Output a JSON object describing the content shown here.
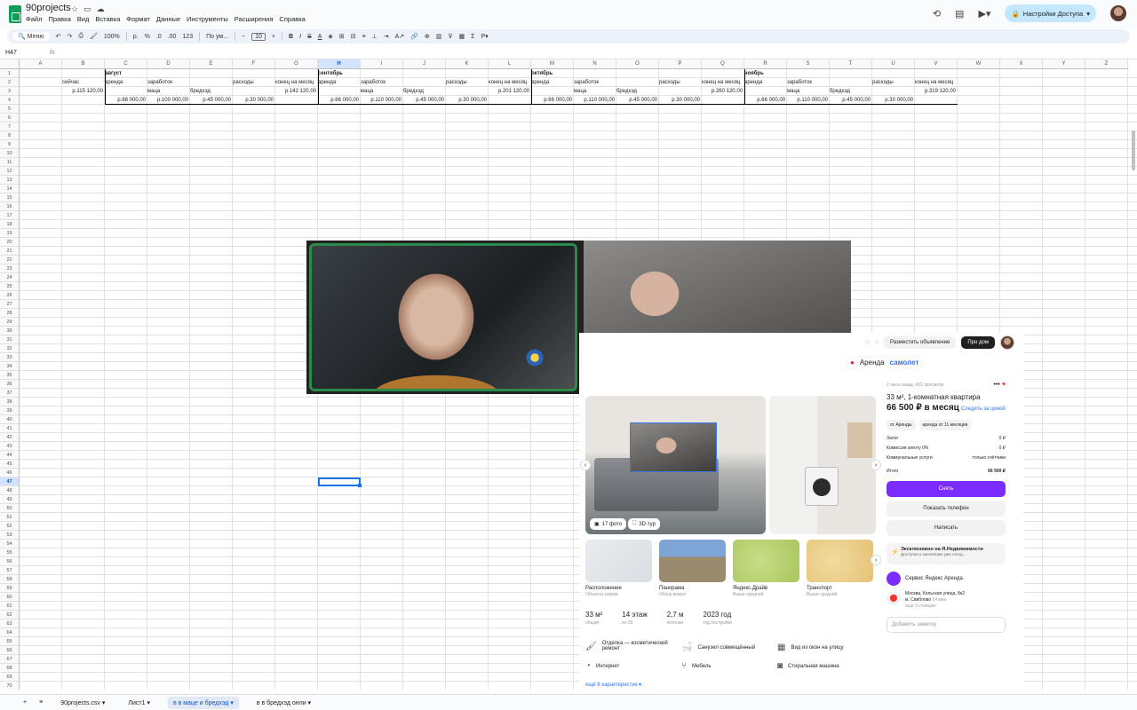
{
  "app": {
    "title": "90projects",
    "menu": [
      "Файл",
      "Правка",
      "Вид",
      "Вставка",
      "Формат",
      "Данные",
      "Инструменты",
      "Расширения",
      "Справка"
    ],
    "share_label": "Настройки Доступа"
  },
  "toolbar": {
    "search": "Меню",
    "zoom": "100%",
    "currency": "р.",
    "percent": "%",
    "dec_minus": ".0",
    "dec_plus": ".00",
    "num_format": "123",
    "font": "По ум...",
    "font_size": "10"
  },
  "formula_bar": {
    "cell_ref": "H47",
    "fx": "fx"
  },
  "columns": [
    "A",
    "B",
    "C",
    "D",
    "E",
    "F",
    "G",
    "H",
    "I",
    "J",
    "K",
    "L",
    "M",
    "N",
    "O",
    "P",
    "Q",
    "R",
    "S",
    "T",
    "U",
    "V",
    "W",
    "X",
    "Y",
    "Z"
  ],
  "selected_col": "H",
  "selected_row": 47,
  "rows_visible": 70,
  "cells": {
    "B2": "сейчас",
    "B3": "р.115 120,00",
    "C1": "август",
    "C2": "аренда",
    "C4": "р.88 000,00",
    "D2": "заработок",
    "D3": "маца",
    "D4": "р.100 000,00",
    "E3": "бредхэд",
    "E4": "р.45 000,00",
    "F2": "расходы",
    "F4": "р.30 000,00",
    "G2": "конец на месяц",
    "G3": "р.142 120,00",
    "H1": "сентябрь",
    "H2": "аренда",
    "H4": "р.66 000,00",
    "I2": "заработок",
    "I3": "маца",
    "I4": "р.110 000,00",
    "J3": "бредхэд",
    "J4": "р.45 000,00",
    "K2": "расходы",
    "K4": "р.30 000,00",
    "L2": "конец на месяц",
    "L3": "р.201 120,00",
    "M1": "октябрь",
    "M2": "аренда",
    "M4": "р.66 000,00",
    "N2": "заработок",
    "N3": "маца",
    "N4": "р.110 000,00",
    "O3": "бредхэд",
    "O4": "р.45 000,00",
    "P2": "расходы",
    "P4": "р.30 000,00",
    "Q2": "конец на месяц",
    "Q3": "р.260 120,00",
    "R1": "ноябрь",
    "R2": "аренда",
    "R4": "р.66 000,00",
    "S2": "заработок",
    "S3": "маца",
    "S4": "р.110 000,00",
    "T3": "бредхэд",
    "T4": "р.45 000,00",
    "U2": "расходы",
    "U4": "р.30 000,00",
    "V2": "конец на месяц",
    "V3": "р.319 120,00"
  },
  "sheets": [
    "90projects.csv",
    "Лист1",
    "в в маце и бредхэд",
    "в в бредхэд онли"
  ],
  "active_sheet": "в в маце и бредхэд",
  "listing": {
    "post_button": "Разместить объявление",
    "pro_button": "Про дом",
    "brand_a": "Аренда",
    "brand_b": "самолет",
    "meta": "2 часа назад, 431 просмотр",
    "title": "33 м², 1-комнатная квартира",
    "price": "66 500 ₽ в месяц",
    "follow": "Следить за ценой",
    "chip1": "от Аренды",
    "chip2": "аренда от 11 месяцев",
    "rows": [
      {
        "k": "Залог",
        "v": "0 ₽"
      },
      {
        "k": "Комиссия агенту 0%",
        "v": "0 ₽"
      },
      {
        "k": "Коммунальные услуги",
        "v": "только счётчики"
      }
    ],
    "total_k": "Итого",
    "total_v": "66 500 ₽",
    "rent_btn": "Снять",
    "phone_btn": "Показать телефон",
    "write_btn": "Написать",
    "promo_title": "Эксклюзивно на Я.Недвижимости",
    "promo_sub": "Доступна к заселению уже сегод...",
    "service": "Сервис Яндекс Аренда",
    "address1": "Москва, Кольская улица, 8к2",
    "address2": "м. Свиблово",
    "address2b": "14 мин.",
    "address3": "ещё 3 станции",
    "note": "Добавить заметку",
    "photos": "17 фото",
    "tour": "3D-тур",
    "thumbs": [
      {
        "title": "Расположение",
        "sub": "Объекты рядом"
      },
      {
        "title": "Панорама",
        "sub": "Обзор вокруг"
      },
      {
        "title": "Яндекс.Драйв",
        "sub": "Выше средней"
      },
      {
        "title": "Транспорт",
        "sub": "Выше средней"
      }
    ],
    "stats": [
      {
        "v": "33 м²",
        "l": "общая"
      },
      {
        "v": "14 этаж",
        "l": "из 25"
      },
      {
        "v": "2,7 м",
        "l": "потолки"
      },
      {
        "v": "2023 год",
        "l": "год постройки"
      }
    ],
    "features": [
      "Отделка — косметический ремонт",
      "Санузел совмещённый",
      "Вид из окон на улицу",
      "Интернет",
      "Мебель",
      "Стиральная машина"
    ],
    "more": "ещё 6 характеристик"
  }
}
